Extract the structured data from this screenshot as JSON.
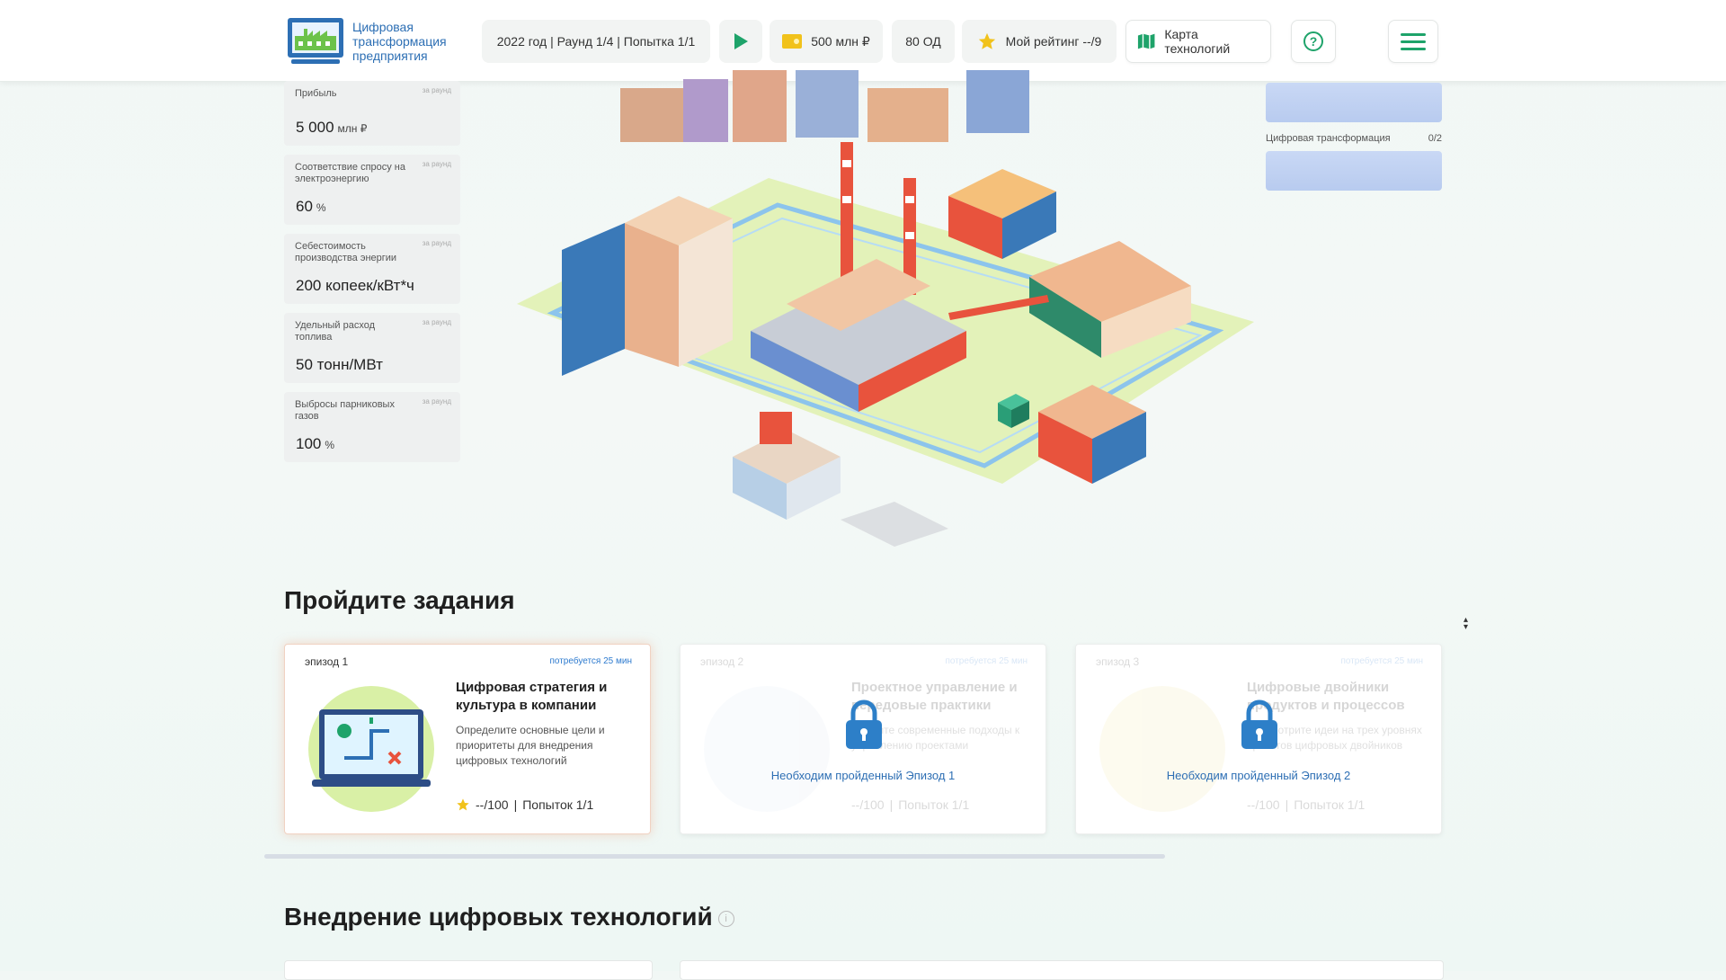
{
  "header": {
    "logo_title": "Цифровая трансформация предприятия",
    "round_info": "2022 год | Раунд 1/4 | Попытка 1/1",
    "money": "500 млн ₽",
    "od": "80 ОД",
    "rating": "Мой рейтинг --/9",
    "tech_map": "Карта технологий",
    "help": "?"
  },
  "metrics": [
    {
      "label": "Прибыль",
      "tag": "за раунд",
      "value": "5 000",
      "unit": "млн ₽"
    },
    {
      "label": "Соответствие спросу на электроэнергию",
      "tag": "за раунд",
      "value": "60",
      "unit": "%"
    },
    {
      "label": "Себестоимость производства энергии",
      "tag": "за раунд",
      "value": "200 копеек/кВт*ч",
      "unit": ""
    },
    {
      "label": "Удельный расход топлива",
      "tag": "за раунд",
      "value": "50 тонн/МВт",
      "unit": ""
    },
    {
      "label": "Выбросы парниковых газов",
      "tag": "за раунд",
      "value": "100",
      "unit": "%"
    }
  ],
  "right_panel": {
    "label": "Цифровая трансформация",
    "count": "0/2"
  },
  "tasks": {
    "title": "Пройдите задания",
    "cards": [
      {
        "episode": "эпизод 1",
        "time": "потребуется 25 мин",
        "title": "Цифровая стратегия и культура в компании",
        "desc": "Определите основные цели и приоритеты для внедрения цифровых технологий",
        "score": "--/100",
        "attempts": "Попыток 1/1"
      },
      {
        "episode": "эпизод 2",
        "time": "потребуется 25 мин",
        "title": "Проектное управление и передовые практики",
        "desc": "Оцените современные подходы к управлению проектами",
        "score": "--/100",
        "attempts": "Попыток 1/1",
        "lock_msg": "Необходим пройденный Эпизод 1"
      },
      {
        "episode": "эпизод 3",
        "time": "потребуется 25 мин",
        "title": "Цифровые двойники продуктов и процессов",
        "desc": "Рассмотрите идеи на трех уровнях проектов цифровых двойников",
        "score": "--/100",
        "attempts": "Попыток 1/1",
        "lock_msg": "Необходим пройденный Эпизод 2"
      }
    ]
  },
  "tech_section": {
    "title": "Внедрение цифровых технологий",
    "info": "i"
  },
  "colors": {
    "accent_green": "#1ea36a",
    "brand_blue": "#2d6fb4",
    "star": "#f1c21b"
  }
}
